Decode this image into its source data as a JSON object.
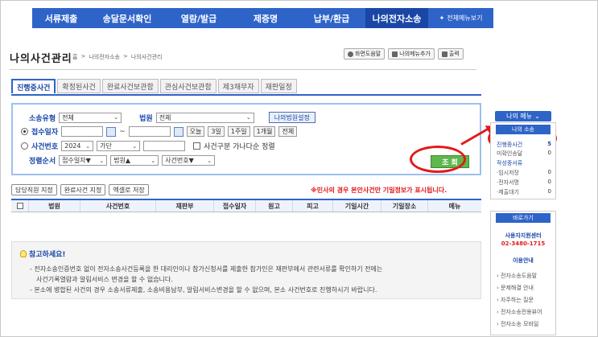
{
  "topnav": {
    "items": [
      "서류제출",
      "송달문서확인",
      "열람/발급",
      "제증명",
      "납부/환급",
      "나의전자소송"
    ],
    "full_menu": "전체메뉴보기"
  },
  "page": {
    "title": "나의사건관리",
    "breadcrumb": [
      "홈",
      ">",
      "나의전자소송",
      ">",
      "나의사건관리"
    ]
  },
  "tools": [
    "화면도움말",
    "나의메뉴추가",
    "출력"
  ],
  "tabs": [
    "진행중사건",
    "확정된사건",
    "완료사건보관함",
    "관심사건보관함",
    "제3채무자",
    "재판일정"
  ],
  "search": {
    "case_type_label": "소송유형",
    "case_type_value": "전체",
    "court_label": "법원",
    "court_value": "전체",
    "my_court_btn": "나의법원설정",
    "date_label": "접수일자",
    "date_sep": "~",
    "date_buttons": [
      "오늘",
      "3일",
      "1주일",
      "1개월",
      "전체"
    ],
    "case_no_label": "사건번호",
    "year_value": "2024",
    "gubun_value": "가단",
    "sort_check_label": "사건구분 가나다순 정렬",
    "order_label": "정렬순서",
    "order1": "접수일자▼",
    "order2": "법원▲",
    "order3": "사건번호▼",
    "search_btn": "조 회"
  },
  "actions": [
    "담당직원 지정",
    "완료사건 지정",
    "엑셀로 저장"
  ],
  "notice": "※민사의 경우 본안사건만 기일정보가 표시됩니다.",
  "table": {
    "headers": [
      "법원",
      "사건번호",
      "재판부",
      "접수일자",
      "원고",
      "피고",
      "기일시간",
      "기일장소",
      "메뉴"
    ]
  },
  "info": {
    "title": "참고하세요!",
    "line1": "- 전자소송인증번호 없이 전자소송사건등록을 한 대리인이나 참가신청서를 제출한 참가인은 재판부에서 관련서류를 확인하기 전에는",
    "line1b": "사건기록열람과 알림서비스 변경을 할 수 없습니다.",
    "line2": "- 본소에 병합된 사건의 경우 소송서류제출, 소송비용납부, 알림서비스변경을 할 수 없으며, 본소 사건번호로 진행하시기 바랍니다."
  },
  "sidebar": {
    "menu_btn": "나의 메뉴",
    "head": "나의 소송",
    "items": [
      {
        "label": "진행중사건",
        "value": "5"
      },
      {
        "label": "미확인송달",
        "value": "0"
      },
      {
        "label": "작성중서류",
        "value": ""
      },
      {
        "label": "·임시저장",
        "value": "0"
      },
      {
        "label": "·전자서명",
        "value": "0"
      },
      {
        "label": "·제출대기",
        "value": "0"
      }
    ],
    "shortcut_head": "바로가기",
    "center_name": "사용자지원센터",
    "center_phone": "02-3480-1715",
    "guide": "이용안내",
    "links": [
      "› 전자소송도움말",
      "› 문제해결 안내",
      "› 자주하는 질문",
      "› 전자소송전용뷰어",
      "› 전자소송 모바일"
    ]
  },
  "colors": {
    "nav": "#2e64c8",
    "accent_red": "#e11b1b",
    "search_green": "#5fb84f"
  }
}
